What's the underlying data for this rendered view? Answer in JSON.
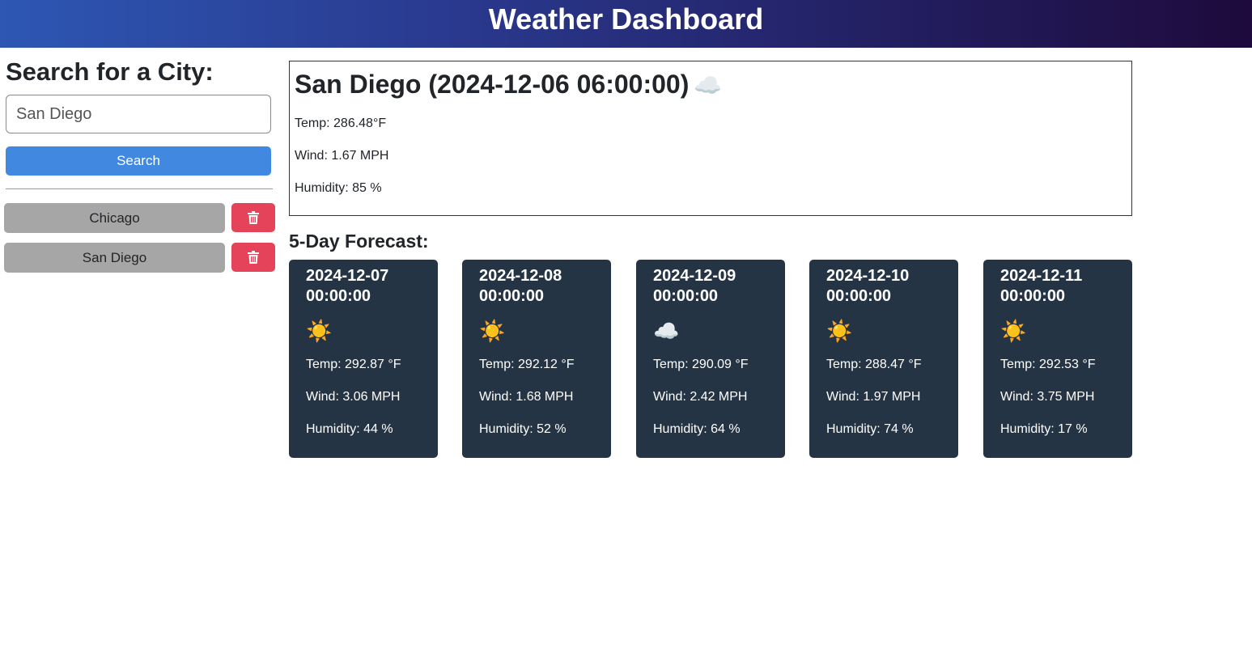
{
  "header": {
    "title": "Weather Dashboard"
  },
  "sidebar": {
    "title": "Search for a City:",
    "search_value": "San Diego",
    "search_button": "Search",
    "history": [
      {
        "label": "Chicago"
      },
      {
        "label": "San Diego"
      }
    ],
    "delete_icon": "trash-icon",
    "colors": {
      "search": "#4189e0",
      "delete": "#e5435a",
      "history": "#a6a6a6"
    }
  },
  "current": {
    "title": "San Diego (2024-12-06 06:00:00)",
    "condition_icon": "☁️",
    "temp": "Temp: 286.48°F",
    "wind": "Wind: 1.67 MPH",
    "humidity": "Humidity: 85 %"
  },
  "forecast": {
    "title": "5-Day Forecast:",
    "days": [
      {
        "date": "2024-12-07 00:00:00",
        "icon": "☀️",
        "temp": "Temp: 292.87 °F",
        "wind": "Wind: 3.06 MPH",
        "humidity": "Humidity: 44 %"
      },
      {
        "date": "2024-12-08 00:00:00",
        "icon": "☀️",
        "temp": "Temp: 292.12 °F",
        "wind": "Wind: 1.68 MPH",
        "humidity": "Humidity: 52 %"
      },
      {
        "date": "2024-12-09 00:00:00",
        "icon": "☁️",
        "temp": "Temp: 290.09 °F",
        "wind": "Wind: 2.42 MPH",
        "humidity": "Humidity: 64 %"
      },
      {
        "date": "2024-12-10 00:00:00",
        "icon": "☀️",
        "temp": "Temp: 288.47 °F",
        "wind": "Wind: 1.97 MPH",
        "humidity": "Humidity: 74 %"
      },
      {
        "date": "2024-12-11 00:00:00",
        "icon": "☀️",
        "temp": "Temp: 292.53 °F",
        "wind": "Wind: 3.75 MPH",
        "humidity": "Humidity: 17 %"
      }
    ]
  }
}
